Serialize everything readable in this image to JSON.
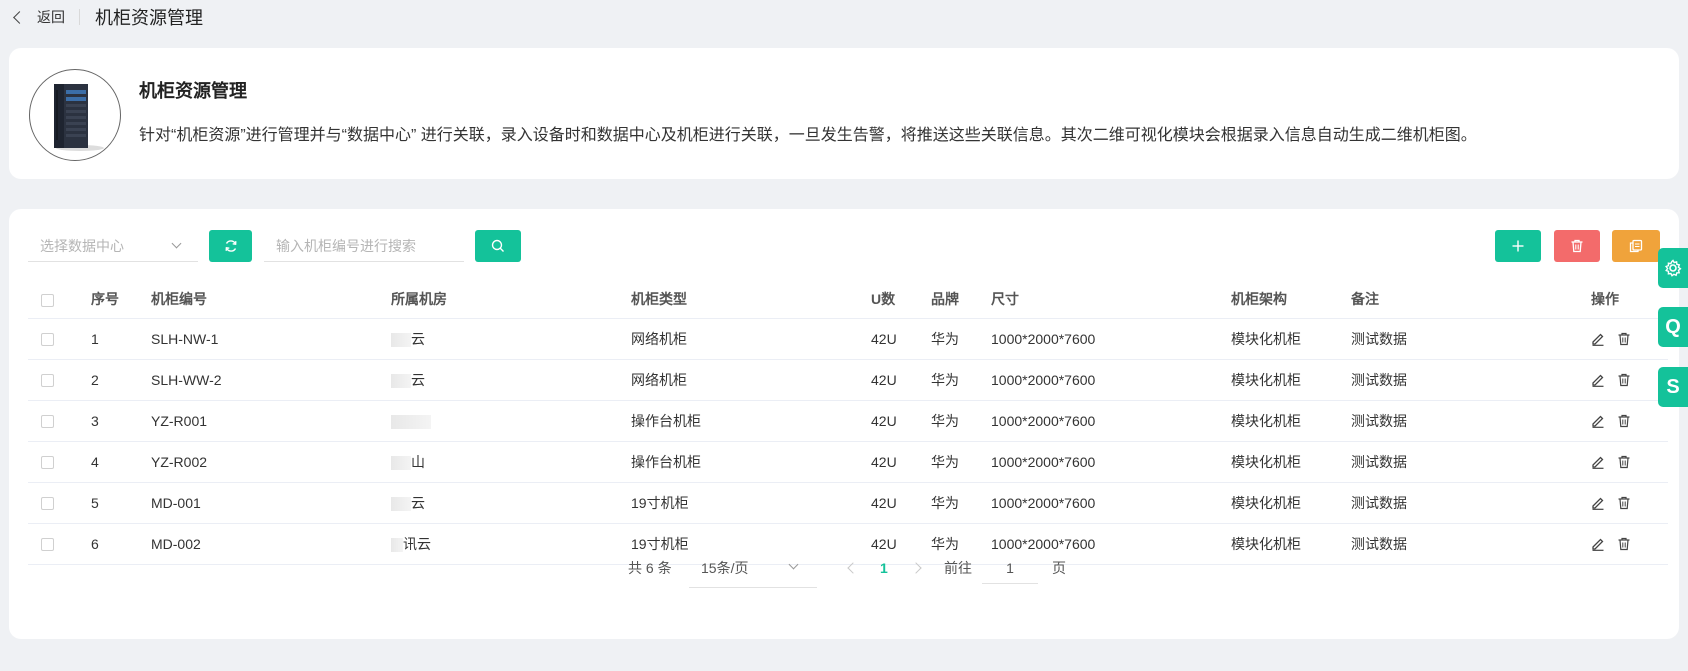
{
  "topbar": {
    "back_label": "返回",
    "title": "机柜资源管理"
  },
  "intro": {
    "title": "机柜资源管理",
    "description": "针对“机柜资源”进行管理并与“数据中心” 进行关联，录入设备时和数据中心及机柜进行关联，一旦发生告警，将推送这些关联信息。其次二维可视化模块会根据录入信息自动生成二维机柜图。"
  },
  "toolbar": {
    "datacenter_placeholder": "选择数据中心",
    "search_placeholder": "输入机柜编号进行搜索",
    "buttons": {
      "refresh_icon": "refresh-icon",
      "search_icon": "search-icon",
      "add_icon": "plus-icon",
      "delete_icon": "trash-icon",
      "copy_icon": "copy-icon"
    }
  },
  "table": {
    "headers": [
      "序号",
      "机柜编号",
      "所属机房",
      "机柜类型",
      "U数",
      "品牌",
      "尺寸",
      "机柜架构",
      "备注",
      "操作"
    ],
    "rows": [
      {
        "index": "1",
        "code": "SLH-NW-1",
        "room": "云",
        "type": "网络机柜",
        "u": "42U",
        "brand": "华为",
        "size": "1000*2000*7600",
        "arch": "模块化机柜",
        "remark": "测试数据"
      },
      {
        "index": "2",
        "code": "SLH-WW-2",
        "room": "云",
        "type": "网络机柜",
        "u": "42U",
        "brand": "华为",
        "size": "1000*2000*7600",
        "arch": "模块化机柜",
        "remark": "测试数据"
      },
      {
        "index": "3",
        "code": "YZ-R001",
        "room": "",
        "type": "操作台机柜",
        "u": "42U",
        "brand": "华为",
        "size": "1000*2000*7600",
        "arch": "模块化机柜",
        "remark": "测试数据"
      },
      {
        "index": "4",
        "code": "YZ-R002",
        "room": "山",
        "type": "操作台机柜",
        "u": "42U",
        "brand": "华为",
        "size": "1000*2000*7600",
        "arch": "模块化机柜",
        "remark": "测试数据"
      },
      {
        "index": "5",
        "code": "MD-001",
        "room": "云",
        "type": "19寸机柜",
        "u": "42U",
        "brand": "华为",
        "size": "1000*2000*7600",
        "arch": "模块化机柜",
        "remark": "测试数据"
      },
      {
        "index": "6",
        "code": "MD-002",
        "room": "讯云",
        "type": "19寸机柜",
        "u": "42U",
        "brand": "华为",
        "size": "1000*2000*7600",
        "arch": "模块化机柜",
        "remark": "测试数据"
      }
    ]
  },
  "pagination": {
    "total": "共 6 条",
    "page_size": "15条/页",
    "current_page": "1",
    "goto_label": "前往",
    "goto_value": "1",
    "page_unit": "页"
  },
  "side_tabs": [
    {
      "label": ""
    },
    {
      "label": "Q"
    },
    {
      "label": "S"
    }
  ],
  "colors": {
    "accent": "#14c29a",
    "danger": "#f36b6b",
    "warning": "#f0a33b"
  }
}
